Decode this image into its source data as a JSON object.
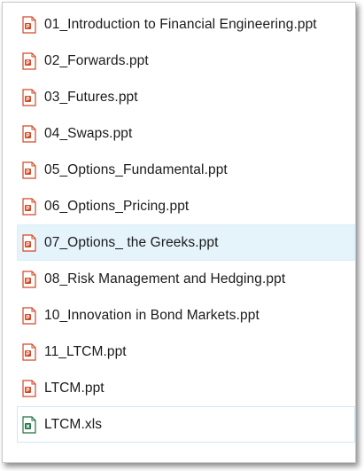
{
  "files": [
    {
      "name": "01_Introduction to Financial Engineering.ppt",
      "icon": "powerpoint-file-icon"
    },
    {
      "name": "02_Forwards.ppt",
      "icon": "powerpoint-file-icon"
    },
    {
      "name": "03_Futures.ppt",
      "icon": "powerpoint-file-icon"
    },
    {
      "name": "04_Swaps.ppt",
      "icon": "powerpoint-file-icon"
    },
    {
      "name": "05_Options_Fundamental.ppt",
      "icon": "powerpoint-file-icon"
    },
    {
      "name": "06_Options_Pricing.ppt",
      "icon": "powerpoint-file-icon"
    },
    {
      "name": "07_Options_ the Greeks.ppt",
      "icon": "powerpoint-file-icon"
    },
    {
      "name": "08_Risk Management and Hedging.ppt",
      "icon": "powerpoint-file-icon"
    },
    {
      "name": "10_Innovation in Bond Markets.ppt",
      "icon": "powerpoint-file-icon"
    },
    {
      "name": "11_LTCM.ppt",
      "icon": "powerpoint-file-icon"
    },
    {
      "name": "LTCM.ppt",
      "icon": "powerpoint-file-icon"
    },
    {
      "name": "LTCM.xls",
      "icon": "excel-file-icon"
    }
  ],
  "colors": {
    "hover_highlight": "#e5f3fb",
    "powerpoint_accent": "#d24726",
    "excel_accent": "#1f7244"
  }
}
